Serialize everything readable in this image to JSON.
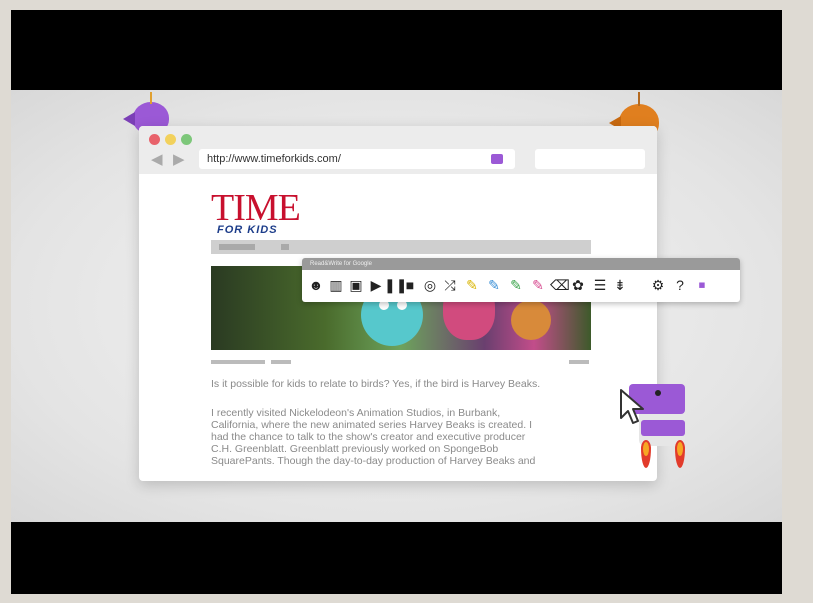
{
  "browser": {
    "url": "http://www.timeforkids.com/",
    "traffic_lights": [
      "#e8626b",
      "#f2d15c",
      "#7dc77a"
    ]
  },
  "page": {
    "logo_title": "TIME",
    "logo_subtitle": "FOR KIDS",
    "lead": "Is it possible for kids to relate to birds? Yes, if the bird is Harvey Beaks.",
    "body_lines": [
      "I recently visited Nickelodeon's Animation Studios, in Burbank,",
      "California, where the new animated series Harvey Beaks is created. I",
      "had the chance to talk to the show's creator and executive producer",
      "C.H. Greenblatt. Greenblatt previously worked on SpongeBob",
      "SquarePants. Though the day-to-day production of Harvey Beaks and"
    ]
  },
  "toolbar": {
    "title": "Read&Write for Google",
    "tools": [
      {
        "icon": "talking-head-icon",
        "glyph": "☻"
      },
      {
        "icon": "dictionary-icon",
        "glyph": "▥"
      },
      {
        "icon": "picture-dictionary-icon",
        "glyph": "▣"
      },
      {
        "icon": "play-icon",
        "glyph": "▶"
      },
      {
        "icon": "pause-icon",
        "glyph": "❚❚"
      },
      {
        "icon": "stop-icon",
        "glyph": "■"
      },
      {
        "icon": "screenshot-reader-icon",
        "glyph": "◎"
      },
      {
        "icon": "translator-icon",
        "glyph": "⤮"
      },
      {
        "icon": "highlight-yellow-icon",
        "glyph": "✎",
        "color": "#d9b400"
      },
      {
        "icon": "highlight-blue-icon",
        "glyph": "✎",
        "color": "#3a8fd6"
      },
      {
        "icon": "highlight-green-icon",
        "glyph": "✎",
        "color": "#3aa34a"
      },
      {
        "icon": "highlight-pink-icon",
        "glyph": "✎",
        "color": "#d64a8f"
      },
      {
        "icon": "clear-highlights-icon",
        "glyph": "⌫"
      },
      {
        "icon": "collect-highlights-icon",
        "glyph": "✿"
      },
      {
        "icon": "vocabulary-list-icon",
        "glyph": "☰"
      },
      {
        "icon": "simplify-page-icon",
        "glyph": "⇟"
      },
      {
        "icon": "settings-icon",
        "glyph": "⚙"
      },
      {
        "icon": "help-icon",
        "glyph": "?"
      },
      {
        "icon": "texthelp-logo-icon",
        "glyph": "▪",
        "color": "#9b59d6"
      }
    ]
  },
  "colors": {
    "accent_purple": "#9b59d6",
    "bird_orange": "#e07f1f",
    "rocket_flame": "#e23b2b"
  }
}
